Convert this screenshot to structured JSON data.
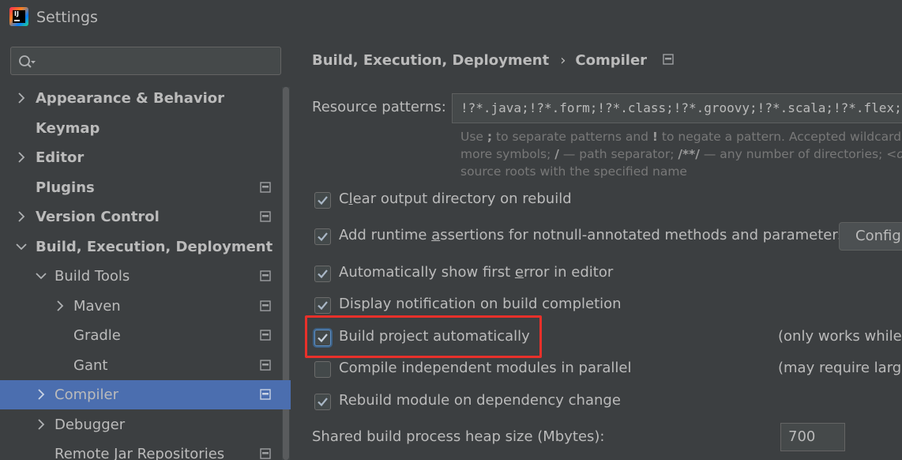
{
  "window": {
    "title": "Settings"
  },
  "search": {
    "placeholder": ""
  },
  "sidebar": {
    "items": [
      {
        "label": "Appearance & Behavior"
      },
      {
        "label": "Keymap"
      },
      {
        "label": "Editor"
      },
      {
        "label": "Plugins"
      },
      {
        "label": "Version Control"
      },
      {
        "label": "Build, Execution, Deployment"
      },
      {
        "label": "Build Tools"
      },
      {
        "label": "Maven"
      },
      {
        "label": "Gradle"
      },
      {
        "label": "Gant"
      },
      {
        "label": "Compiler"
      },
      {
        "label": "Debugger"
      },
      {
        "label": "Remote Jar Repositories"
      }
    ]
  },
  "breadcrumb": {
    "parent": "Build, Execution, Deployment",
    "separator": "›",
    "current": "Compiler"
  },
  "resource_patterns": {
    "label": "Resource patterns:",
    "value": "!?*.java;!?*.form;!?*.class;!?*.groovy;!?*.scala;!?*.flex;!?*.kt;!?*.clj;!?*.aj",
    "hint1_pre": "Use ",
    "hint1_semi": ";",
    "hint1_mid": " to separate patterns and ",
    "hint1_bang": "!",
    "hint1_post": " to negate a pattern. Accepted wildcards:",
    "hint2_pre": "more symbols; ",
    "hint2_slash": "/",
    "hint2_mid": " — path separator; ",
    "hint2_dirs": "/**/",
    "hint2_post": " — any number of directories; ",
    "hint2_dir": "<d",
    "hint3": "source roots with the specified name"
  },
  "options": {
    "clear_output": {
      "label_pre": "C",
      "label_u": "l",
      "label_post": "ear output directory on rebuild",
      "checked": true
    },
    "runtime_assertions": {
      "label_pre": "Add runtime ",
      "label_u": "a",
      "label_post": "ssertions for notnull-annotated methods and parameters",
      "checked": true
    },
    "show_first_error": {
      "label_pre": "Automatically show first ",
      "label_u": "e",
      "label_post": "rror in editor",
      "checked": true
    },
    "build_notification": {
      "label": "Display notification on build completion",
      "checked": true
    },
    "build_automatically": {
      "label": "Build project automatically",
      "checked": true,
      "note": "(only works while n"
    },
    "parallel_modules": {
      "label": "Compile independent modules in parallel",
      "checked": false,
      "note": "(may require large"
    },
    "rebuild_on_dependency": {
      "label": "Rebuild module on dependency change",
      "checked": true
    }
  },
  "configure_button": {
    "label": "Configure..."
  },
  "heap": {
    "label": "Shared build process heap size (Mbytes):",
    "value": "700"
  },
  "colors": {
    "selection": "#4b6eaf",
    "highlight": "#e8302a",
    "background": "#3c3f41"
  }
}
